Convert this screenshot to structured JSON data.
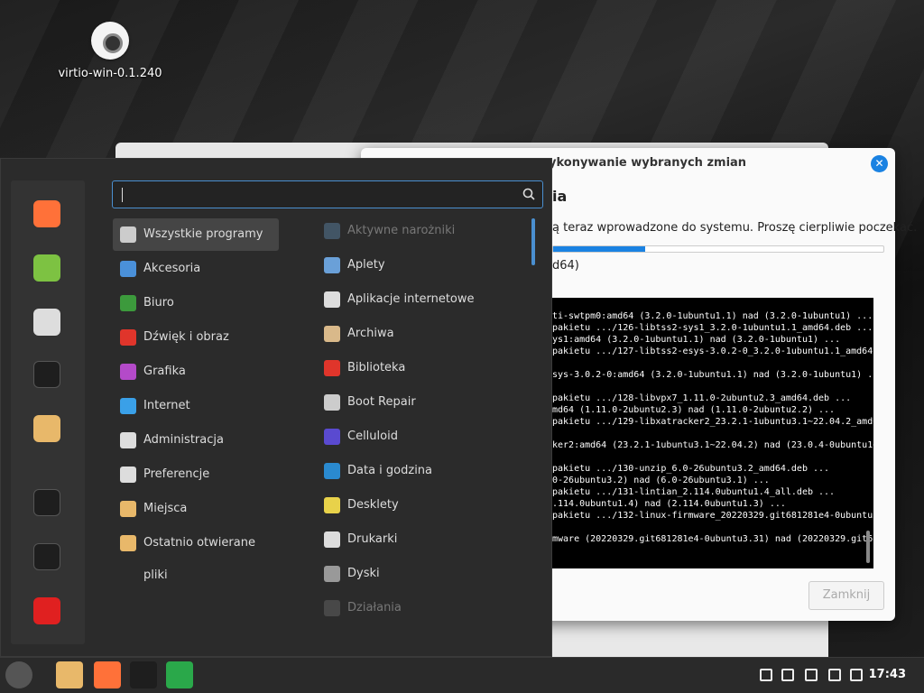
{
  "desktop": {
    "icon_label": "virtio-win-0.1.240"
  },
  "dialog": {
    "title": "ykonywanie wybranych zmian",
    "heading": "ia",
    "description": "ą teraz wprowadzone do systemu. Proszę cierpliwie poczekać.",
    "progress": 0.28,
    "status": "d64)",
    "close_label": "Zamknij",
    "close_icon": "✕",
    "terminal_lines": [
      "ti-swtpm0:amd64 (3.2.0-1ubuntu1.1) nad (3.2.0-1ubuntu1) ...",
      "pakietu .../126-libtss2-sys1_3.2.0-1ubuntu1.1_amd64.deb ...",
      "ys1:amd64 (3.2.0-1ubuntu1.1) nad (3.2.0-1ubuntu1) ...",
      "pakietu .../127-libtss2-esys-3.0.2-0_3.2.0-1ubuntu1.1_amd64.",
      "",
      "sys-3.0.2-0:amd64 (3.2.0-1ubuntu1.1) nad (3.2.0-1ubuntu1) ..",
      "",
      "pakietu .../128-libvpx7_1.11.0-2ubuntu2.3_amd64.deb ...",
      "md64 (1.11.0-2ubuntu2.3) nad (1.11.0-2ubuntu2.2) ...",
      "pakietu .../129-libxatracker2_23.2.1-1ubuntu3.1~22.04.2_amd6",
      "",
      "ker2:amd64 (23.2.1-1ubuntu3.1~22.04.2) nad (23.0.4-0ubuntu1~",
      "",
      "pakietu .../130-unzip_6.0-26ubuntu3.2_amd64.deb ...",
      "0-26ubuntu3.2) nad (6.0-26ubuntu3.1) ...",
      "pakietu .../131-lintian_2.114.0ubuntu1.4_all.deb ...",
      ".114.0ubuntu1.4) nad (2.114.0ubuntu1.3) ...",
      "pakietu .../132-linux-firmware_20220329.git681281e4-0ubuntu3",
      "",
      "mware (20220329.git681281e4-0ubuntu3.31) nad (20220329.git68"
    ]
  },
  "menu": {
    "search_value": "",
    "categories": [
      {
        "label": "Wszystkie programy",
        "icon": "grid-icon",
        "color": "#cccccc"
      },
      {
        "label": "Akcesoria",
        "icon": "scissors-icon",
        "color": "#4a90d9"
      },
      {
        "label": "Biuro",
        "icon": "office-icon",
        "color": "#3c9a3c"
      },
      {
        "label": "Dźwięk i obraz",
        "icon": "play-icon",
        "color": "#e0352b"
      },
      {
        "label": "Grafika",
        "icon": "graphics-icon",
        "color": "#b44ac9"
      },
      {
        "label": "Internet",
        "icon": "cloud-icon",
        "color": "#3aa0e8"
      },
      {
        "label": "Administracja",
        "icon": "admin-icon",
        "color": "#dddddd"
      },
      {
        "label": "Preferencje",
        "icon": "preferences-icon",
        "color": "#dddddd"
      },
      {
        "label": "Miejsca",
        "icon": "folder-icon",
        "color": "#e8b86a"
      },
      {
        "label": "Ostatnio otwierane pliki",
        "icon": "recent-folder-icon",
        "color": "#e8b86a"
      }
    ],
    "apps": [
      {
        "label": "Aktywne narożniki",
        "icon": "hot-corners-icon",
        "color": "#5a7fa0",
        "dim": true
      },
      {
        "label": "Aplety",
        "icon": "applets-icon",
        "color": "#6aa0d8",
        "dim": false
      },
      {
        "label": "Aplikacje internetowe",
        "icon": "web-apps-icon",
        "color": "#dddddd",
        "dim": false
      },
      {
        "label": "Archiwa",
        "icon": "archive-icon",
        "color": "#d9b98a",
        "dim": false
      },
      {
        "label": "Biblioteka",
        "icon": "library-icon",
        "color": "#e0352b",
        "dim": false
      },
      {
        "label": "Boot Repair",
        "icon": "boot-repair-icon",
        "color": "#cccccc",
        "dim": false
      },
      {
        "label": "Celluloid",
        "icon": "celluloid-icon",
        "color": "#5a4ad0",
        "dim": false
      },
      {
        "label": "Data i godzina",
        "icon": "clock-icon",
        "color": "#2a8ad0",
        "dim": false
      },
      {
        "label": "Desklety",
        "icon": "desklets-icon",
        "color": "#e8d24a",
        "dim": false
      },
      {
        "label": "Drukarki",
        "icon": "printer-icon",
        "color": "#dddddd",
        "dim": false
      },
      {
        "label": "Dyski",
        "icon": "disks-icon",
        "color": "#999999",
        "dim": false
      },
      {
        "label": "Działania",
        "icon": "actions-icon",
        "color": "#666666",
        "dim": true
      }
    ],
    "favorites": [
      {
        "icon": "firefox-icon",
        "color": "#ff7139"
      },
      {
        "icon": "software-manager-icon",
        "color": "#7dc242"
      },
      {
        "icon": "settings-icon",
        "color": "#dddddd"
      },
      {
        "icon": "terminal-icon",
        "color": "#1e1e1e"
      },
      {
        "icon": "files-icon",
        "color": "#e8b86a"
      },
      {
        "icon": "lock-icon",
        "color": "#1e1e1e"
      },
      {
        "icon": "logout-icon",
        "color": "#1e1e1e"
      },
      {
        "icon": "shutdown-icon",
        "color": "#e02020"
      }
    ]
  },
  "panel": {
    "launchers": [
      {
        "icon": "mint-menu-icon"
      },
      {
        "icon": "files-icon"
      },
      {
        "icon": "firefox-icon"
      },
      {
        "icon": "terminal-icon"
      },
      {
        "icon": "update-manager-icon"
      }
    ],
    "clock": "17:43",
    "tray": [
      "update-icon",
      "shield-icon",
      "notes-icon",
      "network-icon",
      "volume-icon"
    ]
  }
}
